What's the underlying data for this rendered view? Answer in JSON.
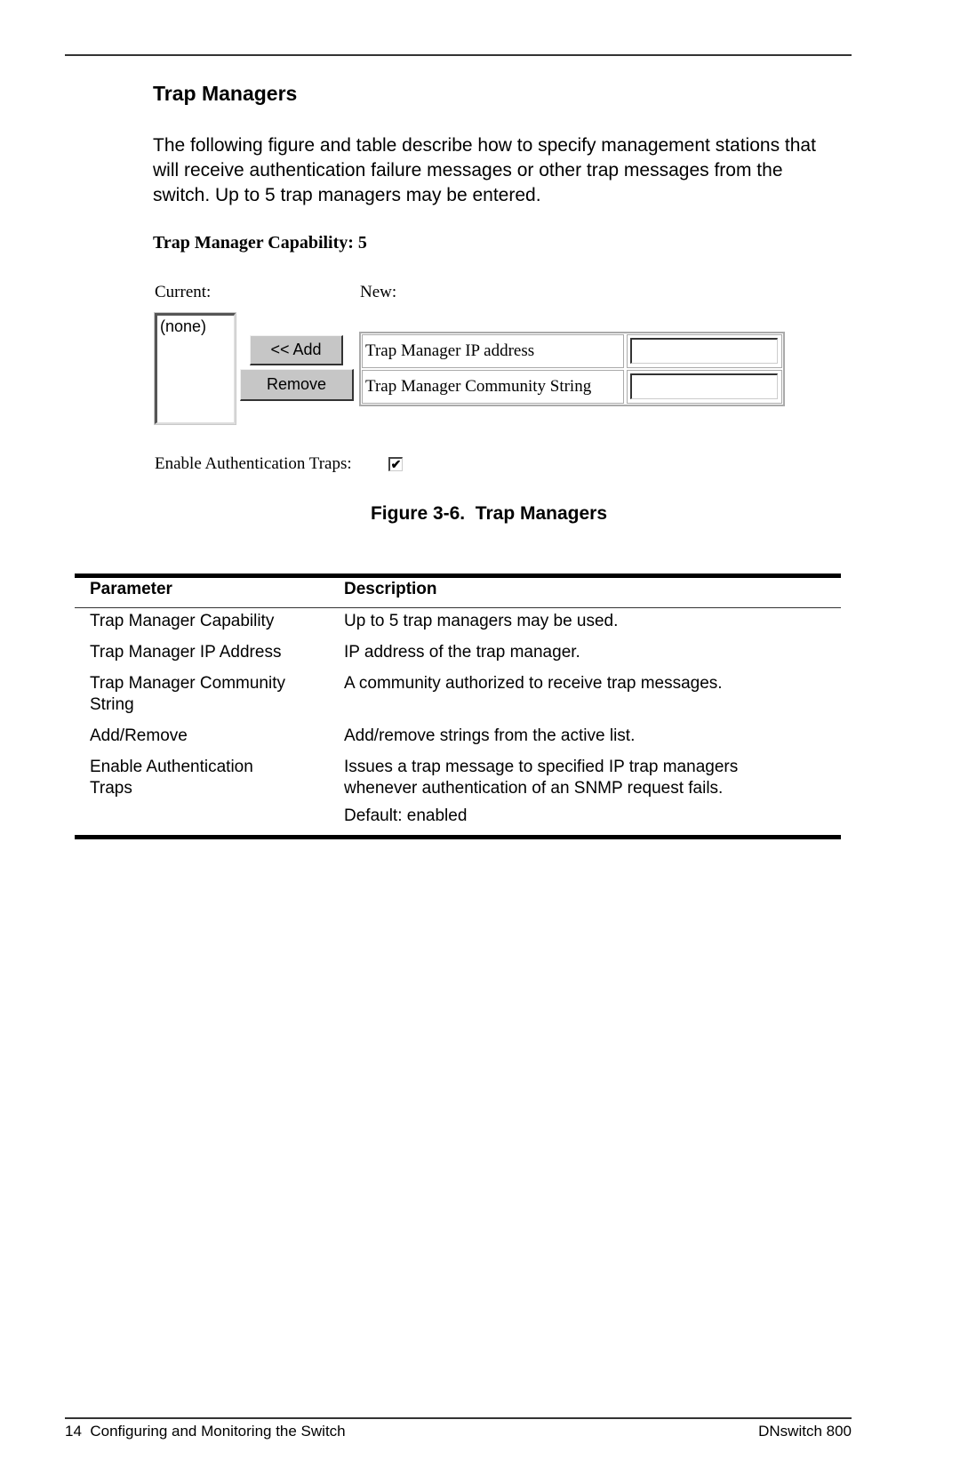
{
  "section": {
    "title": "Trap Managers",
    "intro": "The following figure and table describe how to specify management stations that will receive authentication failure messages or other trap messages from the switch. Up to 5 trap managers may be entered."
  },
  "figure": {
    "capability_heading": "Trap Manager Capability: 5",
    "current_label": "Current:",
    "new_label": "New:",
    "current_list": [
      "(none)"
    ],
    "add_button": "<< Add",
    "remove_button": "Remove",
    "fields": [
      {
        "label": "Trap Manager IP address",
        "value": ""
      },
      {
        "label": "Trap Manager Community String",
        "value": ""
      }
    ],
    "enable_auth_label": "Enable Authentication Traps:",
    "enable_auth_checked": true,
    "check_glyph": "✔",
    "caption": "Figure 3-6.  Trap Managers"
  },
  "param_table": {
    "headers": [
      "Parameter",
      "Description"
    ],
    "rows": [
      {
        "param": "Trap Manager Capability",
        "desc": "Up to 5 trap managers may be used."
      },
      {
        "param": "Trap Manager IP Address",
        "desc": "IP address of the trap manager."
      },
      {
        "param": "Trap Manager Community String",
        "desc": "A community authorized to receive trap messages."
      },
      {
        "param": "Add/Remove",
        "desc": "Add/remove strings from the active list."
      },
      {
        "param": "Enable Authentication Traps",
        "desc": "Issues a trap message to specified IP trap managers whenever authentication of an SNMP request fails.",
        "note": "Default: enabled"
      }
    ]
  },
  "footer": {
    "left": "14  Configuring and Monitoring the Switch",
    "right": "DNswitch 800"
  }
}
